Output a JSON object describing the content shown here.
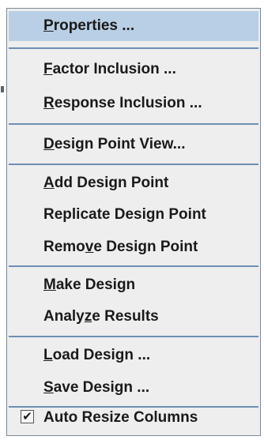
{
  "menu": {
    "items": [
      {
        "pre": "",
        "mnemonic": "P",
        "post": "roperties ..."
      },
      {
        "pre": "",
        "mnemonic": "F",
        "post": "actor Inclusion ..."
      },
      {
        "pre": "",
        "mnemonic": "R",
        "post": "esponse Inclusion ..."
      },
      {
        "pre": "",
        "mnemonic": "D",
        "post": "esign Point View..."
      },
      {
        "pre": "",
        "mnemonic": "A",
        "post": "dd Design Point"
      },
      {
        "pre": "Replicate Design Point",
        "mnemonic": "",
        "post": ""
      },
      {
        "pre": "Remo",
        "mnemonic": "v",
        "post": "e Design Point"
      },
      {
        "pre": "",
        "mnemonic": "M",
        "post": "ake Design"
      },
      {
        "pre": "Analy",
        "mnemonic": "z",
        "post": "e Results"
      },
      {
        "pre": "",
        "mnemonic": "L",
        "post": "oad Design ..."
      },
      {
        "pre": "",
        "mnemonic": "S",
        "post": "ave Design ..."
      },
      {
        "pre": "Auto Resize Columns",
        "mnemonic": "",
        "post": ""
      }
    ],
    "auto_resize_checked": true,
    "auto_resize_check_glyph": "✔"
  },
  "colors": {
    "menu_background": "#eeeeee",
    "highlight": "#b8cfe5",
    "separator": "#6d8fb4",
    "text": "#1a1a1a"
  }
}
